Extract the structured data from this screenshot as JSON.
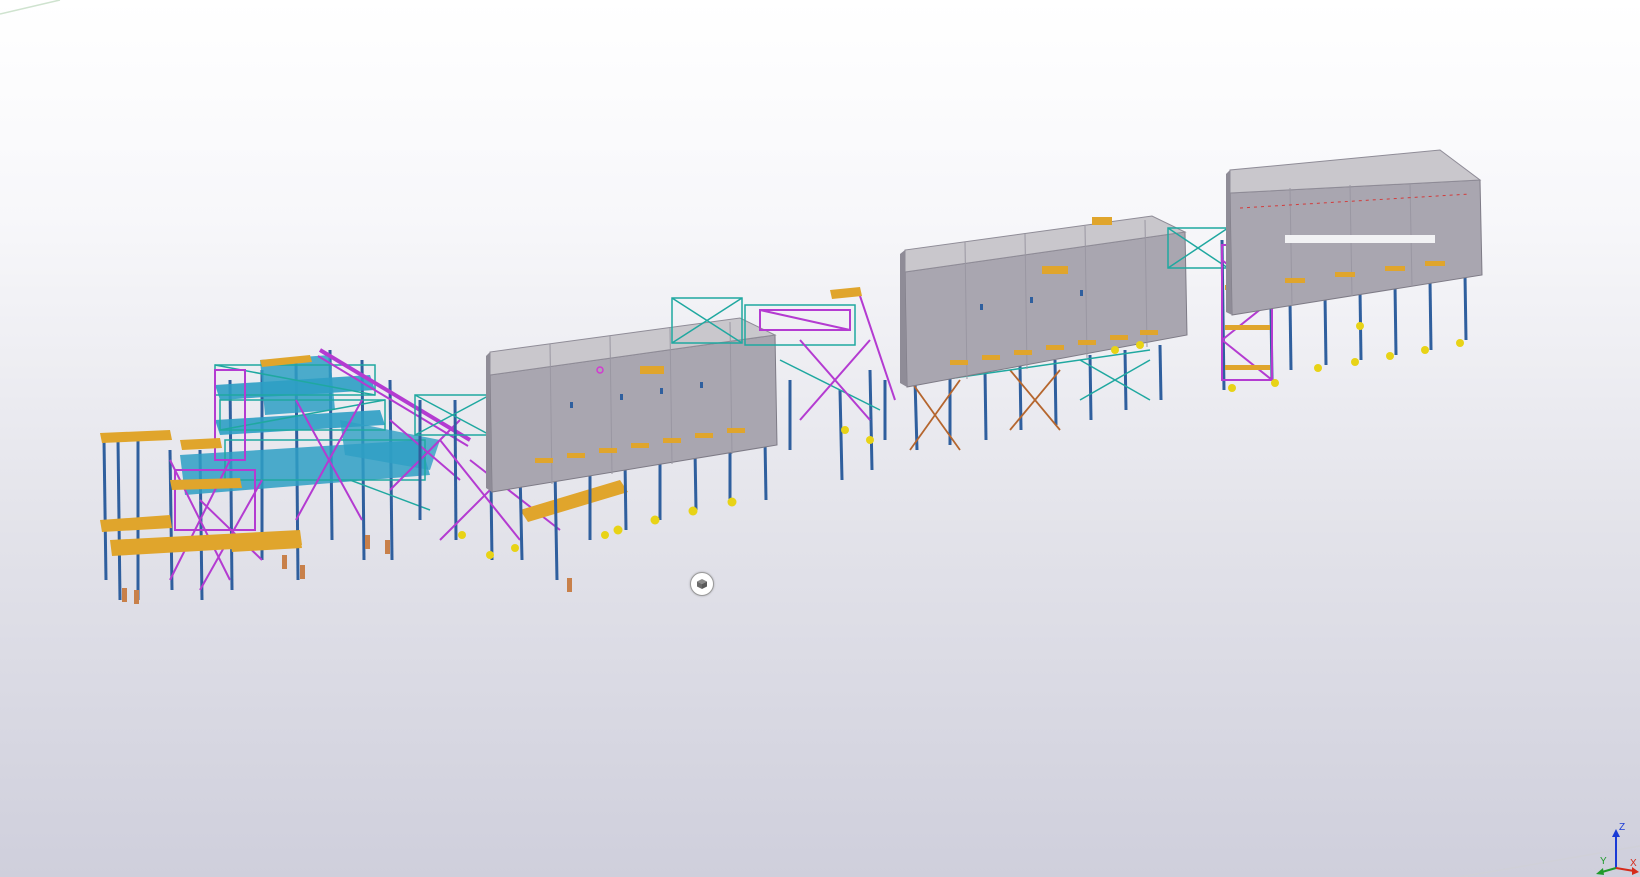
{
  "viewport": {
    "background_top": "#ffffff",
    "background_bottom": "#cfcfdc"
  },
  "model": {
    "colors": {
      "cladding": "#a9a6b0",
      "cladding_dark": "#8f8c97",
      "roof": "#c9c7cc",
      "column_blue": "#2f5f9e",
      "brace_magenta": "#b43bd1",
      "beam_teal": "#1fa8a0",
      "grating_cyan": "#2e9fc4",
      "platform_orange": "#e0a52c",
      "footing_yellow": "#e8d316",
      "pile_tan": "#c8804a",
      "brace_brown": "#b5662e"
    },
    "buildings": [
      "building-1",
      "building-2",
      "building-3"
    ]
  },
  "nav_cube": {
    "icon": "cube-icon"
  },
  "axis_gizmo": {
    "z_label": "Z",
    "y_label": "Y",
    "x_label": "X",
    "z_color": "#1a3bd6",
    "y_color": "#1f9a2a",
    "x_color": "#d62a1a"
  }
}
